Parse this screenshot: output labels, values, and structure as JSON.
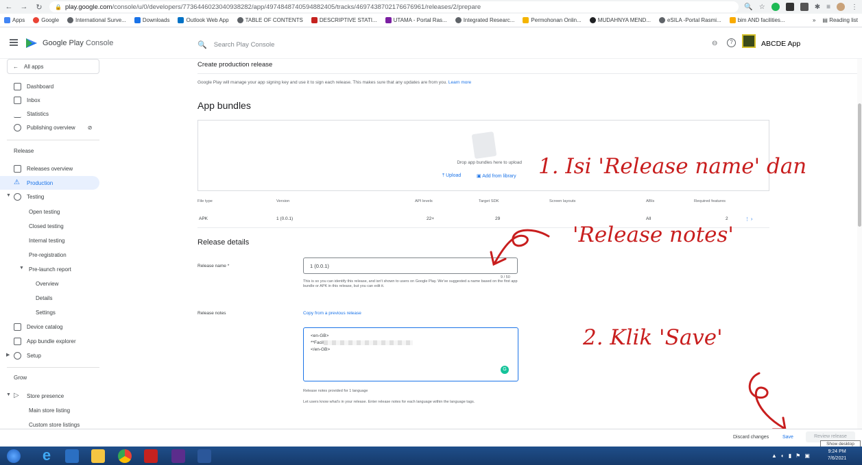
{
  "browser": {
    "url_host": "play.google.com",
    "url_path": "/console/u/0/developers/7736446023040938282/app/4974848740594882405/tracks/4697438702176676961/releases/2/prepare",
    "bookmarks": [
      "Apps",
      "Google",
      "International Surve...",
      "Downloads",
      "Outlook Web App",
      "TABLE OF CONTENTS",
      "DESCRIPTIVE STATI...",
      "UTAMA - Portal Ras...",
      "Integrated Researc...",
      "Permohonan Onlin...",
      "MUDAHNYA MEND...",
      "eSILA -Portal Rasmi...",
      "bim AND facilities..."
    ],
    "reading_list": "Reading list"
  },
  "header": {
    "brand": "Google Play",
    "brand_suffix": "Console",
    "search_placeholder": "Search Play Console",
    "app_name": "ABCDE App"
  },
  "sidebar": {
    "all_apps": "All apps",
    "items": [
      "Dashboard",
      "Inbox",
      "Statistics",
      "Publishing overview"
    ],
    "release_section": "Release",
    "release_items": [
      "Releases overview",
      "Production",
      "Testing"
    ],
    "testing_items": [
      "Open testing",
      "Closed testing",
      "Internal testing",
      "Pre-registration",
      "Pre-launch report"
    ],
    "prelaunch_items": [
      "Overview",
      "Details",
      "Settings"
    ],
    "more_items": [
      "Device catalog",
      "App bundle explorer",
      "Setup"
    ],
    "grow_section": "Grow",
    "grow_items": [
      "Store presence",
      "Main store listing",
      "Custom store listings"
    ]
  },
  "main": {
    "page_title": "Create production release",
    "intro": "Google Play will manage your app signing key and use it to sign each release. This makes sure that any updates are from you.",
    "intro_link": "Learn more",
    "bundles_title": "App bundles",
    "drop_text": "Drop app bundles here to upload",
    "upload_label": "Upload",
    "library_label": "Add from library",
    "table_headers": [
      "File type",
      "Version",
      "API levels",
      "Target SDK",
      "Screen layouts",
      "ABIs",
      "Required features"
    ],
    "table_row": [
      "APK",
      "1 (0.0.1)",
      "22+",
      "29",
      "",
      "All",
      "2"
    ],
    "details_title": "Release details",
    "release_name_label": "Release name *",
    "release_name_value": "1 (0.0.1)",
    "release_name_counter": "9 / 50",
    "release_name_help": "This is so you can identify this release, and isn't shown to users on Google Play. We've suggested a name based on the first app bundle or APK in this release, but you can edit it.",
    "release_notes_label": "Release notes",
    "copy_link": "Copy from a previous release",
    "notes_line1": "<en-GB>",
    "notes_line2": "**Facil",
    "notes_line3": "</en-GB>",
    "notes_help1": "Release notes provided for 1 language",
    "notes_help2": "Let users know what's in your release. Enter release notes for each language within the language tags."
  },
  "annotations": {
    "step1_line1": "1. Isi 'Release name' dan",
    "step1_line2": "'Release notes'",
    "step2": "2. Klik 'Save'"
  },
  "footer": {
    "discard": "Discard changes",
    "save": "Save",
    "review": "Review release",
    "tooltip": "Show desktop"
  },
  "taskbar": {
    "time": "9:24 PM",
    "date": "7/6/2021"
  },
  "colors": {
    "accent": "#1a73e8",
    "annotation": "#c81e1e",
    "taskbar": "#1f4e8a"
  }
}
